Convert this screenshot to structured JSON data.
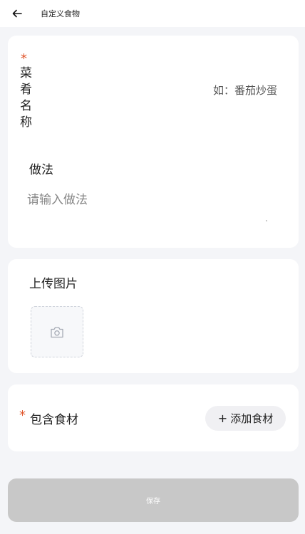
{
  "header": {
    "title": "自定义食物",
    "back_icon": "arrow-left-icon"
  },
  "dish": {
    "required_mark": "*",
    "name_label": "菜肴名称",
    "name_placeholder": "如：番茄炒蛋",
    "method_label": "做法",
    "method_placeholder": "请输入做法"
  },
  "photo": {
    "label": "上传图片",
    "upload_icon": "camera-icon"
  },
  "ingredients": {
    "required_mark": "*",
    "label": "包含食材",
    "add_plus": "+",
    "add_label": "添加食材"
  },
  "footer": {
    "save_label": "保存"
  },
  "colors": {
    "required": "#e0552b",
    "background": "#f4f5f8",
    "save_disabled": "#c8c8c8"
  }
}
